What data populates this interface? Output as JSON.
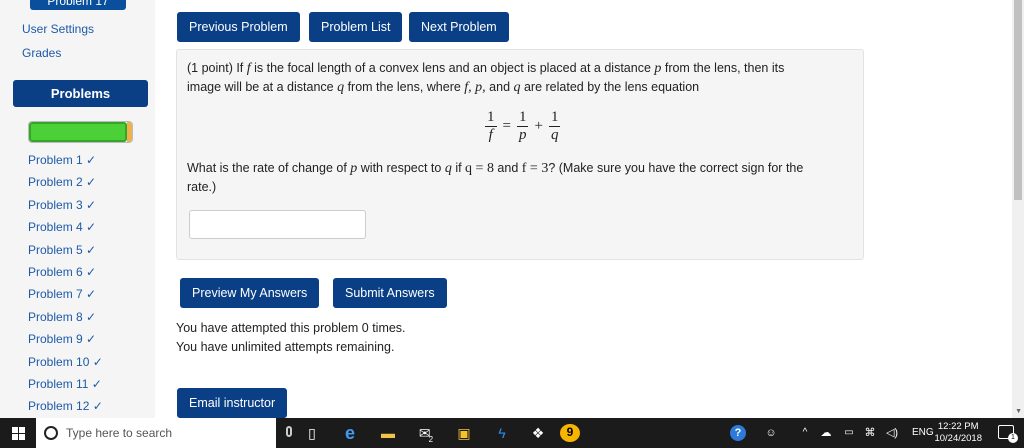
{
  "sidebar": {
    "problem_title": "Problem 17",
    "links": [
      "User Settings",
      "Grades"
    ],
    "problems_header": "Problems",
    "progress": {
      "fraction": 0.95
    },
    "problem_list": [
      "Problem 1 ✓",
      "Problem 2 ✓",
      "Problem 3 ✓",
      "Problem 4 ✓",
      "Problem 5 ✓",
      "Problem 6 ✓",
      "Problem 7 ✓",
      "Problem 8 ✓",
      "Problem 9 ✓",
      "Problem 10 ✓",
      "Problem 11 ✓",
      "Problem 12 ✓"
    ]
  },
  "nav": {
    "previous": "Previous Problem",
    "list": "Problem List",
    "next": "Next Problem"
  },
  "problem": {
    "line1_a": "(1 point) If ",
    "f": "f",
    "line1_b": " is the focal length of a convex lens and an object is placed at a distance ",
    "p": "p",
    "line1_c": " from the lens, then its",
    "line2_a": "image will be at a distance ",
    "q": "q",
    "line2_b": " from the lens, where ",
    "fpq": "f, p,",
    "line2_c": " and ",
    "line2_d": " are related by the lens equation",
    "eq": {
      "one": "1",
      "eq": "=",
      "plus": "+",
      "f": "f",
      "p": "p",
      "q": "q"
    },
    "question_a": "What is the rate of change of ",
    "question_b": " with respect to ",
    "question_c": " if ",
    "q_val": "q = 8",
    "question_d": " and ",
    "f_val": "f = 3",
    "question_e": "? (Make sure you have the correct sign for the",
    "question_f": "rate.)",
    "answer_value": ""
  },
  "actions": {
    "preview": "Preview My Answers",
    "submit": "Submit Answers",
    "email": "Email instructor"
  },
  "status": {
    "attempted": "You have attempted this problem 0 times.",
    "remaining": "You have unlimited attempts remaining."
  },
  "taskbar": {
    "search_placeholder": "Type here to search",
    "lang": "ENG",
    "time": "12:22 PM",
    "date": "10/24/2018",
    "notification_count": "1",
    "badge_icon": "2",
    "icons": [
      "windows-icon",
      "search-icon",
      "mic-icon",
      "task-view-icon",
      "edge-icon",
      "file-explorer-icon",
      "mail-icon",
      "store-icon",
      "lightning-icon",
      "dropbox-icon",
      "chrome-icon"
    ]
  },
  "colors": {
    "accent": "#0a3f86",
    "link": "#1e5aa8",
    "progress": "#4cd037"
  }
}
